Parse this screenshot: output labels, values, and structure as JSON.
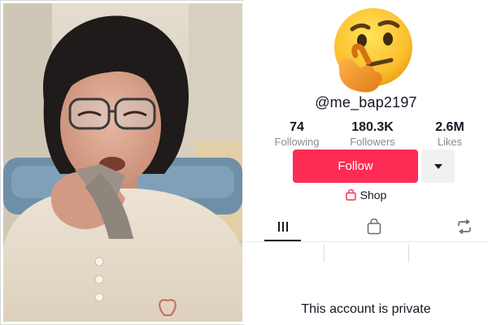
{
  "profile": {
    "username": "@me_bap2197",
    "avatar_icon": "thinking-face-emoji-icon",
    "stats": [
      {
        "value": "74",
        "label": "Following"
      },
      {
        "value": "180.3K",
        "label": "Followers"
      },
      {
        "value": "2.6M",
        "label": "Likes"
      }
    ],
    "follow_label": "Follow",
    "more_icon": "caret-down-icon",
    "shop_label": "Shop",
    "tabs": [
      {
        "icon": "videos-grid-icon",
        "selected": true
      },
      {
        "icon": "shopping-bag-icon",
        "selected": false
      },
      {
        "icon": "repost-icon",
        "selected": false
      }
    ],
    "private_message": "This account is private"
  },
  "colors": {
    "follow_button": "#fe2c55",
    "more_button": "#f1f1f2",
    "text": "#161823",
    "muted_text": "#8a8b91"
  }
}
